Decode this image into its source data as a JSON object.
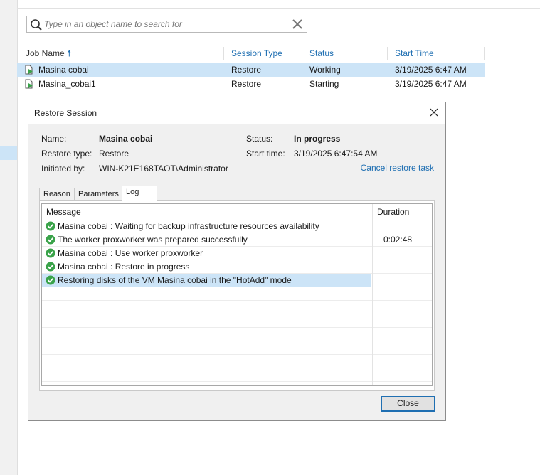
{
  "search": {
    "placeholder": "Type in an object name to search for"
  },
  "jobs": {
    "columns": {
      "name": "Job Name",
      "session_type": "Session Type",
      "status": "Status",
      "start_time": "Start Time"
    },
    "rows": [
      {
        "name": "Masina cobai",
        "session_type": "Restore",
        "status": "Working",
        "start_time": "3/19/2025 6:47 AM"
      },
      {
        "name": "Masina_cobai1",
        "session_type": "Restore",
        "status": "Starting",
        "start_time": "3/19/2025 6:47 AM"
      }
    ]
  },
  "dialog": {
    "title": "Restore Session",
    "name_label": "Name:",
    "name_value": "Masina cobai",
    "restore_type_label": "Restore type:",
    "restore_type_value": "Restore",
    "initiated_label": "Initiated by:",
    "initiated_value": "WIN-K21E168TAOT\\Administrator",
    "status_label": "Status:",
    "status_value": "In progress",
    "start_time_label": "Start time:",
    "start_time_value": "3/19/2025 6:47:54 AM",
    "cancel_link": "Cancel restore task",
    "tabs": [
      "Reason",
      "Parameters",
      "Log"
    ],
    "log": {
      "col_message": "Message",
      "col_duration": "Duration",
      "rows": [
        {
          "message": "Masina cobai : Waiting for backup infrastructure resources availability",
          "duration": ""
        },
        {
          "message": "The worker proxworker was prepared successfully",
          "duration": "0:02:48"
        },
        {
          "message": "Masina cobai : Use worker proxworker",
          "duration": ""
        },
        {
          "message": "Masina cobai : Restore in progress",
          "duration": ""
        },
        {
          "message": "Restoring disks of the VM Masina cobai in the \"HotAdd\" mode",
          "duration": ""
        }
      ]
    },
    "close_label": "Close"
  },
  "colors": {
    "accent": "#1f6fb2",
    "selection": "#cce4f7",
    "success": "#3aa34a"
  }
}
